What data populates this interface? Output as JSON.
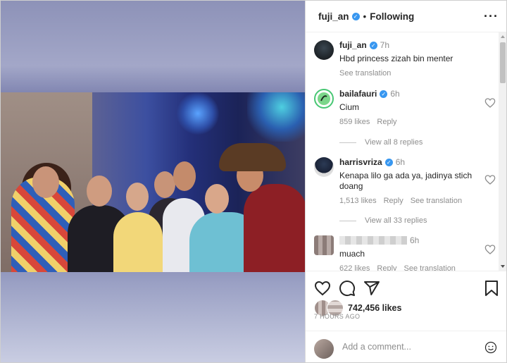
{
  "header": {
    "username": "fuji_an",
    "separator": "•",
    "follow_status": "Following",
    "more": "···"
  },
  "caption": {
    "username": "fuji_an",
    "time": "7h",
    "text": "Hbd princess zizah bin menter",
    "see_translation": "See translation"
  },
  "comments": [
    {
      "username": "bailafauri",
      "time": "6h",
      "text": "Cium",
      "likes": "859 likes",
      "reply": "Reply",
      "view_replies": "View all 8 replies"
    },
    {
      "username": "harrisvriza",
      "time": "6h",
      "text": "Kenapa lilo ga ada ya, jadinya stich doang",
      "likes": "1,513 likes",
      "reply": "Reply",
      "see_translation": "See translation",
      "view_replies": "View all 33 replies"
    },
    {
      "username": "",
      "time": "6h",
      "text": "muach",
      "likes": "622 likes",
      "reply": "Reply",
      "see_translation": "See translation"
    }
  ],
  "post": {
    "likes": "742,456 likes",
    "ago": "7 HOURS AGO"
  },
  "composer": {
    "placeholder": "Add a comment..."
  },
  "colors": {
    "verified": "#3897f0",
    "text": "#262626",
    "muted": "#8e8e8e"
  }
}
